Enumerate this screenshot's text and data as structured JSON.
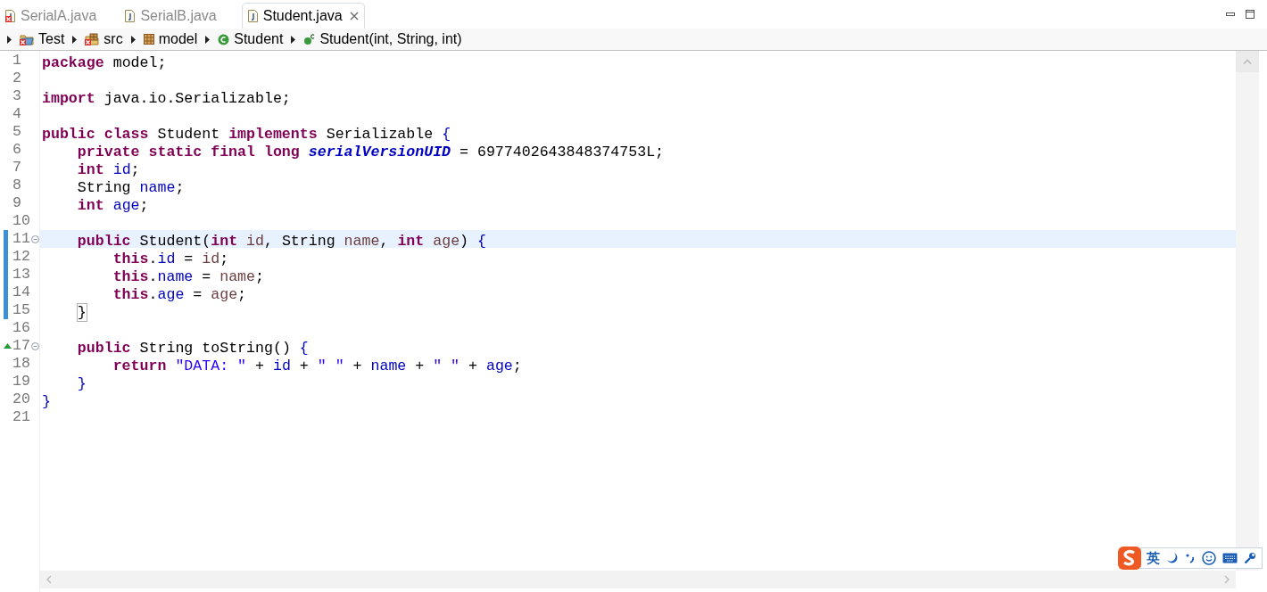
{
  "tabs": [
    {
      "label": "SerialA.java",
      "selected": false,
      "error": true,
      "closable": false
    },
    {
      "label": "SerialB.java",
      "selected": false,
      "error": false,
      "closable": false
    },
    {
      "label": "Student.java",
      "selected": true,
      "error": false,
      "closable": true
    }
  ],
  "breadcrumb": [
    {
      "kind": "project",
      "label": "Test",
      "error": true
    },
    {
      "kind": "source-folder",
      "label": "src",
      "error": true
    },
    {
      "kind": "package",
      "label": "model",
      "error": false
    },
    {
      "kind": "class",
      "label": "Student",
      "error": false
    },
    {
      "kind": "constructor",
      "label": "Student(int, String, int)",
      "error": false
    }
  ],
  "lines": [
    {
      "num": "1",
      "changed": false,
      "fold": false,
      "override": false,
      "current": false,
      "tokens": [
        {
          "kind": "keyword",
          "text": "package"
        },
        {
          "kind": "plain",
          "text": " model;"
        }
      ]
    },
    {
      "num": "2",
      "changed": false,
      "fold": false,
      "override": false,
      "current": false
    },
    {
      "num": "3",
      "changed": false,
      "fold": false,
      "override": false,
      "current": false,
      "tokens": [
        {
          "kind": "keyword",
          "text": "import"
        },
        {
          "kind": "plain",
          "text": " java.io.Serializable;"
        }
      ]
    },
    {
      "num": "4",
      "changed": false,
      "fold": false,
      "override": false,
      "current": false
    },
    {
      "num": "5",
      "changed": false,
      "fold": false,
      "override": false,
      "current": false,
      "tokens": [
        {
          "kind": "keyword",
          "text": "public class"
        },
        {
          "kind": "plain",
          "text": " Student "
        },
        {
          "kind": "keyword",
          "text": "implements"
        },
        {
          "kind": "plain",
          "text": " Serializable "
        },
        {
          "kind": "brace",
          "text": "{"
        }
      ]
    },
    {
      "num": "6",
      "changed": false,
      "fold": false,
      "override": false,
      "current": false,
      "tokens": [
        {
          "kind": "keyword",
          "text": "    private static final long "
        },
        {
          "kind": "static",
          "text": "serialVersionUID"
        },
        {
          "kind": "plain",
          "text": " = 6977402643848374753L;"
        }
      ]
    },
    {
      "num": "7",
      "changed": false,
      "fold": false,
      "override": false,
      "current": false,
      "tokens": [
        {
          "kind": "keyword",
          "text": "    int "
        },
        {
          "kind": "field",
          "text": "id"
        },
        {
          "kind": "plain",
          "text": ";"
        }
      ]
    },
    {
      "num": "8",
      "changed": false,
      "fold": false,
      "override": false,
      "current": false,
      "tokens": [
        {
          "kind": "plain",
          "text": "    String "
        },
        {
          "kind": "field",
          "text": "name"
        },
        {
          "kind": "plain",
          "text": ";"
        }
      ]
    },
    {
      "num": "9",
      "changed": false,
      "fold": false,
      "override": false,
      "current": false,
      "tokens": [
        {
          "kind": "keyword",
          "text": "    int "
        },
        {
          "kind": "field",
          "text": "age"
        },
        {
          "kind": "plain",
          "text": ";"
        }
      ]
    },
    {
      "num": "10",
      "changed": false,
      "fold": false,
      "override": false,
      "current": false
    },
    {
      "num": "11",
      "changed": true,
      "fold": true,
      "override": false,
      "current": true,
      "tokens": [
        {
          "kind": "keyword",
          "text": "    public"
        },
        {
          "kind": "plain",
          "text": " Student("
        },
        {
          "kind": "keyword",
          "text": "int "
        },
        {
          "kind": "param",
          "text": "id"
        },
        {
          "kind": "plain",
          "text": ", String "
        },
        {
          "kind": "param",
          "text": "name"
        },
        {
          "kind": "plain",
          "text": ", "
        },
        {
          "kind": "keyword",
          "text": "int "
        },
        {
          "kind": "param",
          "text": "age"
        },
        {
          "kind": "plain",
          "text": ") "
        },
        {
          "kind": "brace",
          "text": "{"
        }
      ]
    },
    {
      "num": "12",
      "changed": true,
      "fold": false,
      "override": false,
      "current": false,
      "tokens": [
        {
          "kind": "keyword",
          "text": "        this"
        },
        {
          "kind": "plain",
          "text": "."
        },
        {
          "kind": "field",
          "text": "id"
        },
        {
          "kind": "plain",
          "text": " = "
        },
        {
          "kind": "param",
          "text": "id"
        },
        {
          "kind": "plain",
          "text": ";"
        }
      ]
    },
    {
      "num": "13",
      "changed": true,
      "fold": false,
      "override": false,
      "current": false,
      "tokens": [
        {
          "kind": "keyword",
          "text": "        this"
        },
        {
          "kind": "plain",
          "text": "."
        },
        {
          "kind": "field",
          "text": "name"
        },
        {
          "kind": "plain",
          "text": " = "
        },
        {
          "kind": "param",
          "text": "name"
        },
        {
          "kind": "plain",
          "text": ";"
        }
      ]
    },
    {
      "num": "14",
      "changed": true,
      "fold": false,
      "override": false,
      "current": false,
      "tokens": [
        {
          "kind": "keyword",
          "text": "        this"
        },
        {
          "kind": "plain",
          "text": "."
        },
        {
          "kind": "field",
          "text": "age"
        },
        {
          "kind": "plain",
          "text": " = "
        },
        {
          "kind": "param",
          "text": "age"
        },
        {
          "kind": "plain",
          "text": ";"
        }
      ]
    },
    {
      "num": "15",
      "changed": true,
      "fold": false,
      "override": false,
      "current": false,
      "tokens": [
        {
          "kind": "matched",
          "text": "    }"
        }
      ]
    },
    {
      "num": "16",
      "changed": false,
      "fold": false,
      "override": false,
      "current": false
    },
    {
      "num": "17",
      "changed": false,
      "fold": true,
      "override": true,
      "current": false,
      "tokens": [
        {
          "kind": "keyword",
          "text": "    public"
        },
        {
          "kind": "plain",
          "text": " String toString() "
        },
        {
          "kind": "brace",
          "text": "{"
        }
      ]
    },
    {
      "num": "18",
      "changed": false,
      "fold": false,
      "override": false,
      "current": false,
      "tokens": [
        {
          "kind": "keyword",
          "text": "        return "
        },
        {
          "kind": "string",
          "text": "\"DATA: \""
        },
        {
          "kind": "plain",
          "text": " + "
        },
        {
          "kind": "field",
          "text": "id"
        },
        {
          "kind": "plain",
          "text": " + "
        },
        {
          "kind": "string",
          "text": "\" \""
        },
        {
          "kind": "plain",
          "text": " + "
        },
        {
          "kind": "field",
          "text": "name"
        },
        {
          "kind": "plain",
          "text": " + "
        },
        {
          "kind": "string",
          "text": "\" \""
        },
        {
          "kind": "plain",
          "text": " + "
        },
        {
          "kind": "field",
          "text": "age"
        },
        {
          "kind": "plain",
          "text": ";"
        }
      ]
    },
    {
      "num": "19",
      "changed": false,
      "fold": false,
      "override": false,
      "current": false,
      "tokens": [
        {
          "kind": "brace",
          "text": "    }"
        }
      ]
    },
    {
      "num": "20",
      "changed": false,
      "fold": false,
      "override": false,
      "current": false,
      "tokens": [
        {
          "kind": "brace",
          "text": "}"
        }
      ]
    },
    {
      "num": "21",
      "changed": false,
      "fold": false,
      "override": false,
      "current": false
    }
  ],
  "ime_toolbar": {
    "mode_label": "英"
  }
}
